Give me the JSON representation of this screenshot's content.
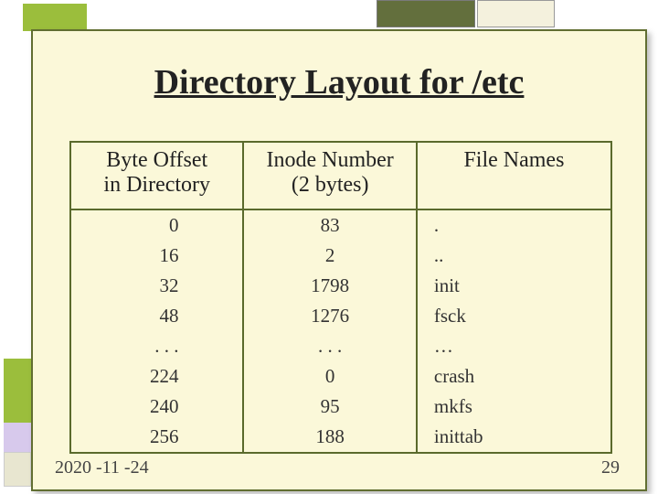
{
  "title": "Directory Layout for /etc",
  "columns": {
    "c1l1": "Byte Offset",
    "c1l2": "in Directory",
    "c2l1": "Inode Number",
    "c2l2": "(2 bytes)",
    "c3l1": "File Names",
    "c3l2": ""
  },
  "rows": [
    {
      "offset": "0",
      "inode": "83",
      "name": "."
    },
    {
      "offset": "16",
      "inode": "2",
      "name": ".."
    },
    {
      "offset": "32",
      "inode": "1798",
      "name": "init"
    },
    {
      "offset": "48",
      "inode": "1276",
      "name": "fsck"
    },
    {
      "offset": ". . .",
      "inode": ". . .",
      "name": "…"
    },
    {
      "offset": "224",
      "inode": "0",
      "name": "crash"
    },
    {
      "offset": "240",
      "inode": "95",
      "name": "mkfs"
    },
    {
      "offset": "256",
      "inode": "188",
      "name": "inittab"
    }
  ],
  "footer": {
    "date": "2020 -11 -24",
    "page": "29"
  },
  "chart_data": {
    "type": "table",
    "title": "Directory Layout for /etc",
    "columns": [
      "Byte Offset in Directory",
      "Inode Number (2 bytes)",
      "File Names"
    ],
    "rows": [
      [
        0,
        83,
        "."
      ],
      [
        16,
        2,
        ".."
      ],
      [
        32,
        1798,
        "init"
      ],
      [
        48,
        1276,
        "fsck"
      ],
      [
        "...",
        "...",
        "…"
      ],
      [
        224,
        0,
        "crash"
      ],
      [
        240,
        95,
        "mkfs"
      ],
      [
        256,
        188,
        "inittab"
      ]
    ]
  }
}
